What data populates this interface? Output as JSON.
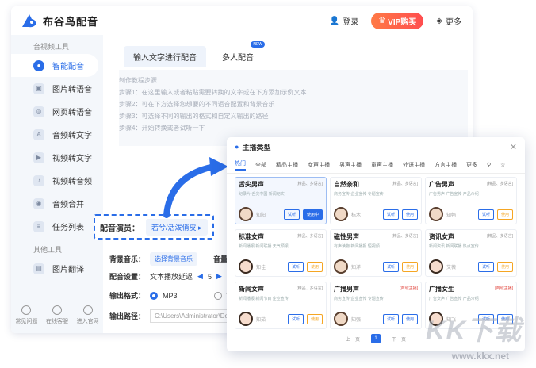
{
  "app": {
    "title": "布谷鸟配音"
  },
  "topbar": {
    "login": "登录",
    "vip": "VIP购买",
    "more": "更多"
  },
  "sidebar": {
    "section1": "音视频工具",
    "items": [
      {
        "label": "智能配音",
        "active": true
      },
      {
        "label": "图片转语音"
      },
      {
        "label": "网页转语音"
      },
      {
        "label": "音频转文字"
      },
      {
        "label": "视频转文字"
      },
      {
        "label": "视频转音频"
      },
      {
        "label": "音频合并"
      },
      {
        "label": "任务列表"
      }
    ],
    "section2": "其他工具",
    "items2": [
      {
        "label": "图片翻译"
      }
    ],
    "bottom": [
      "常见问题",
      "在线客服",
      "进入官网"
    ]
  },
  "tabs": {
    "tab1": "输入文字进行配音",
    "tab2": "多人配音",
    "badge": "NEW"
  },
  "steps": {
    "title": "制作教程步骤",
    "s1": "步骤1：在这里输入或者粘贴需要转换的文字或在下方添加示例文本",
    "s2": "步骤2：可在下方选择您想要的不同语音配置和背景音乐",
    "s3": "步骤3：可选择不同的输出的格式和自定义输出的路径",
    "s4": "步骤4：开始转换或者试听一下"
  },
  "form": {
    "voice_label": "配音演员：",
    "voice_value": "若兮/活泼俏皮",
    "bgm_label": "背景音乐：",
    "bgm_value": "选择背景音乐",
    "volume_label": "音量：",
    "settings_label": "配音设置：",
    "settings_value": "文本播放延迟",
    "settings_num": "5",
    "format_label": "输出格式：",
    "format1": "MP3",
    "format2": "WA",
    "path_label": "输出路径：",
    "path_value": "C:\\Users\\Administrator\\Docu"
  },
  "popup": {
    "title": "主播类型",
    "categories": [
      "热门",
      "全部",
      "精品主播",
      "女声主播",
      "男声主播",
      "童声主播",
      "外语主播",
      "方言主播",
      "更多"
    ],
    "cards": [
      {
        "name": "舌尖男声",
        "tag": "[精品、多语言]",
        "desc": "纪录片  舌尖中国  新闻纪实",
        "voice": "知阳",
        "use": "使用中",
        "active": true
      },
      {
        "name": "自然亲和",
        "tag": "[精品、多语言]",
        "desc": "商务宣传  企业宣传  专题宣传",
        "voice": "标木",
        "use": "使用"
      },
      {
        "name": "广告男声",
        "tag": "[精品、多语言]",
        "desc": "广告男声  广告宣传  产品介绍",
        "voice": "知畅",
        "use": "使用"
      },
      {
        "name": "标准女声",
        "tag": "[精品、多语言]",
        "desc": "新闻播报  新闻联播  天气预报",
        "voice": "知佳",
        "use": "使用"
      },
      {
        "name": "磁性男声",
        "tag": "[精品、多语言]",
        "desc": "有声读物  新闻播报  短视频",
        "voice": "知洋",
        "use": "使用"
      },
      {
        "name": "资讯女声",
        "tag": "[精品、多语言]",
        "desc": "新闻资讯  新闻联播  热点宣传",
        "voice": "艾薇",
        "use": "使用"
      },
      {
        "name": "新闻女声",
        "tag": "[精品、多语言]",
        "desc": "新闻播报  新闻节目  企业宣传",
        "voice": "知茹",
        "use": "使用"
      },
      {
        "name": "广播男声",
        "tag": "[商城主播]",
        "desc": "商务宣传  企业宣传  专题宣传",
        "voice": "知强",
        "use": "使用",
        "red": true
      },
      {
        "name": "广播女生",
        "tag": "[商城主播]",
        "desc": "广告女声  广告宣传  产品介绍",
        "voice": "知飞",
        "use": "使用",
        "red": true
      }
    ],
    "try": "试听",
    "pager": {
      "prev": "上一页",
      "page": "1",
      "next": "下一页"
    }
  },
  "watermark": {
    "brand": "KK下载",
    "url": "www.kkx.net"
  },
  "colors": {
    "accent": "#2a6de8",
    "vip": "#ff5a3c"
  }
}
